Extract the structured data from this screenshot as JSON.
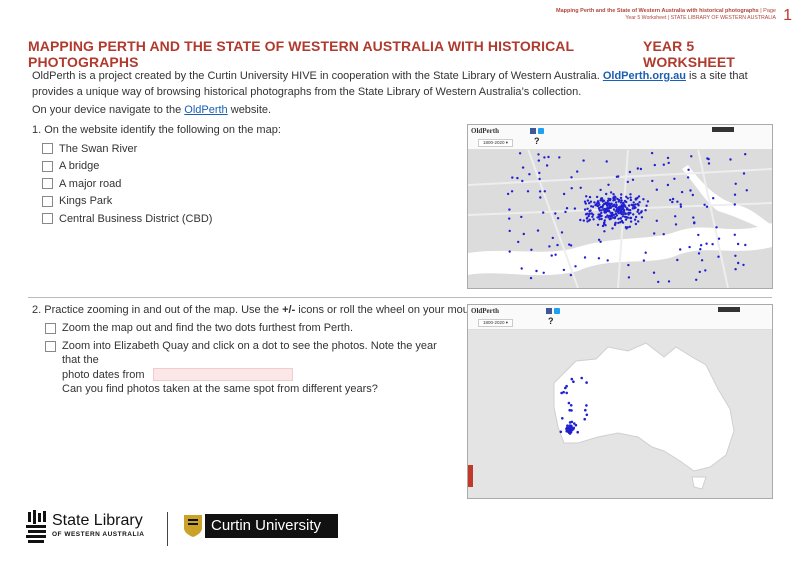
{
  "header": {
    "line1_bold": "Mapping Perth and the State of Western Australia with historical photographs",
    "line1_page": "| Page",
    "line2": "Year 5 Worksheet | STATE LIBRARY OF WESTERN AUSTRALIA",
    "page_number": "1"
  },
  "title": {
    "main": "MAPPING PERTH AND THE STATE OF WESTERN AUSTRALIA WITH HISTORICAL PHOTOGRAPHS",
    "year": "YEAR 5 WORKSHEET"
  },
  "intro": {
    "text1": "OldPerth is a project created by the Curtin University HIVE in cooperation with the State Library of Western Australia. ",
    "link": "OldPerth.org.au",
    "text2": " is a site that provides a unique way of browsing historical photographs from the State Library of Western Australia’s collection."
  },
  "nav": {
    "text": "On your device navigate to the ",
    "link": "OldPerth",
    "text2": " website."
  },
  "q1": {
    "label": "1.  On the website identify the following on the map:",
    "items": [
      "The Swan River",
      "A bridge",
      "A major road",
      "Kings Park",
      "Central Business District (CBD)"
    ]
  },
  "q2": {
    "label_pre": "2.  Practice zooming in and out of the map. Use the ",
    "label_bold": "+/-",
    "label_post": " icons or roll the wheel on your mouse.",
    "item1": "Zoom the map out and find the two dots furthest from Perth.",
    "item2_a": "Zoom into Elizabeth Quay and click on a dot to see the photos. Note the year that the",
    "item2_b": "photo dates from",
    "item2_c": "Can you find photos taken at the same spot from different years?"
  },
  "maps": {
    "logo": "OldPerth",
    "range": "1800-2020 ▾",
    "help": "?"
  },
  "logos": {
    "slwa_name": "State Library",
    "slwa_sub": "OF WESTERN AUSTRALIA",
    "curtin": "Curtin University"
  },
  "colors": {
    "accent": "#b13a2e",
    "link": "#1a5fb4",
    "dots": "#2020d0"
  }
}
